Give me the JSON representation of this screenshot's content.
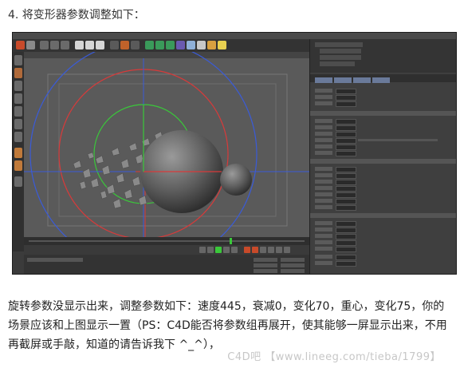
{
  "step_title": "4. 将变形器参数调整如下：",
  "caption": "旋转参数没显示出来，调整参数如下：速度445，衰减0，变化70，重心，变化75，你的场景应该和上图显示一置（PS：C4D能否将参数组再展开，使其能够一屏显示出来，不用再截屏或手敲，知道的请告诉我下 ^_^），",
  "watermark": "C4D吧 【www.lineeg.com/tieba/1799】",
  "colors": {
    "viewport_bg": "#5a5a5a",
    "panel_bg": "#3f3f3f",
    "axis_blue": "#3a5bd8",
    "axis_red": "#d83a3a",
    "axis_green": "#3ac83a",
    "attr_tab": "#6a7a9a"
  }
}
